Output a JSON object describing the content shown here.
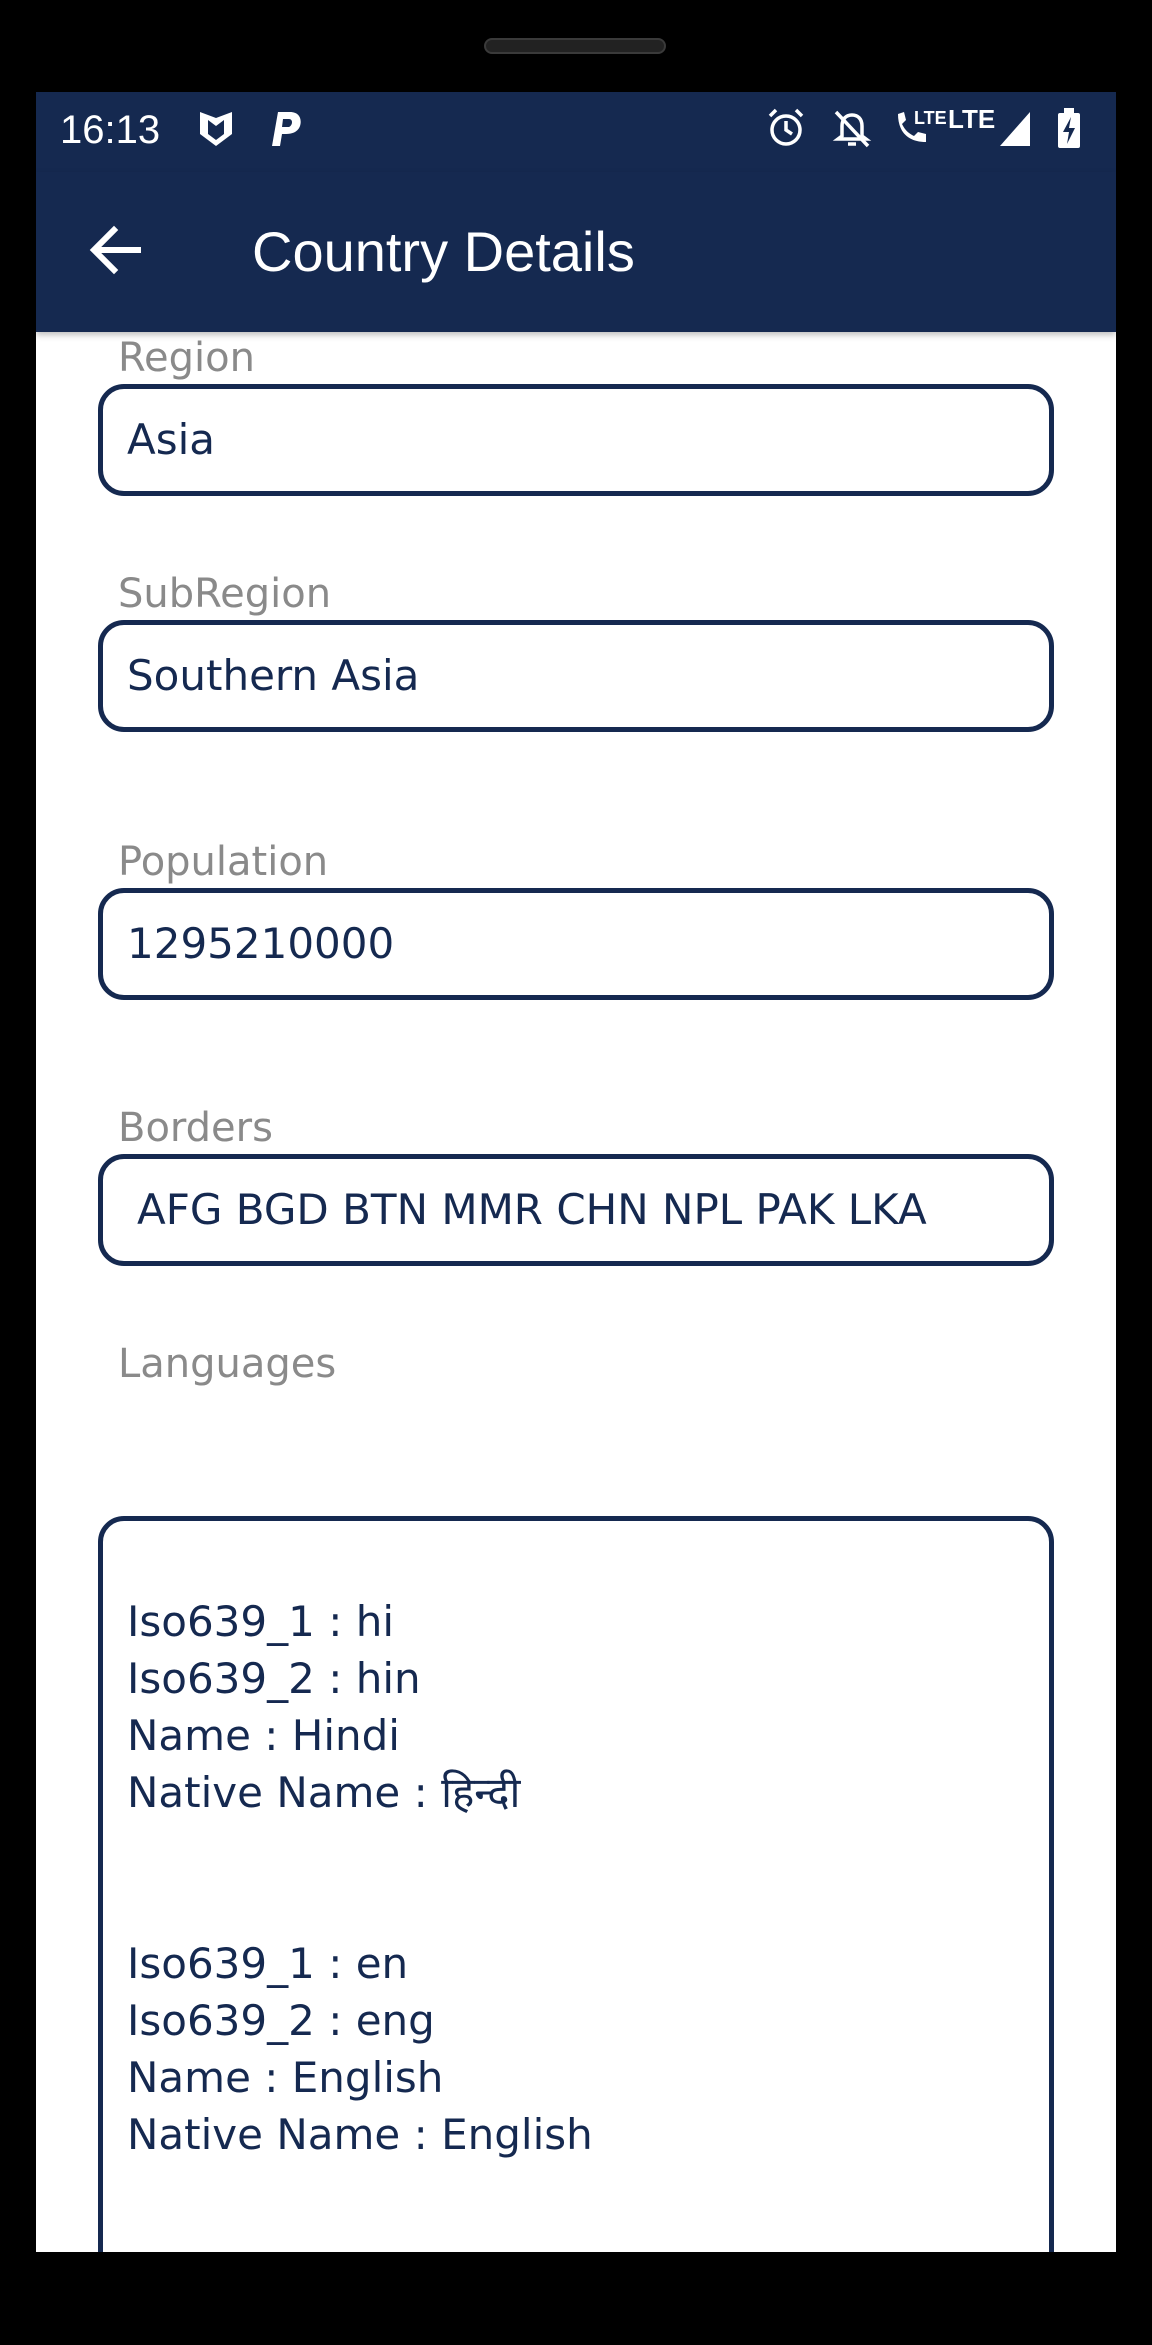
{
  "status_bar": {
    "time": "16:13",
    "left_icons": [
      "shield-app-icon",
      "parking-app-icon"
    ],
    "right_icons": [
      "alarm-icon",
      "notifications-off-icon",
      "volte-call-icon",
      "lte-signal-icon",
      "battery-charging-icon"
    ],
    "volte_label": "LTE",
    "network_label": "LTE"
  },
  "app_bar": {
    "title": "Country Details",
    "back_icon": "arrow-back-icon"
  },
  "fields": {
    "region": {
      "label": "Region",
      "value": "Asia"
    },
    "subregion": {
      "label": "SubRegion",
      "value": "Southern Asia"
    },
    "population": {
      "label": "Population",
      "value": "1295210000"
    },
    "borders": {
      "label": "Borders",
      "value": "AFG BGD BTN MMR CHN NPL PAK LKA"
    }
  },
  "languages": {
    "label": "Languages",
    "items": [
      {
        "iso639_1": "Iso639_1 : hi",
        "iso639_2": "Iso639_2 : hin",
        "name": "Name : Hindi",
        "native_name": "Native Name : हिन्दी"
      },
      {
        "iso639_1": "Iso639_1 : en",
        "iso639_2": "Iso639_2 : eng",
        "name": "Name : English",
        "native_name": "Native Name : English"
      }
    ]
  },
  "colors": {
    "primary": "#152950",
    "label_gray": "#8a8a8a",
    "background": "#ffffff"
  }
}
